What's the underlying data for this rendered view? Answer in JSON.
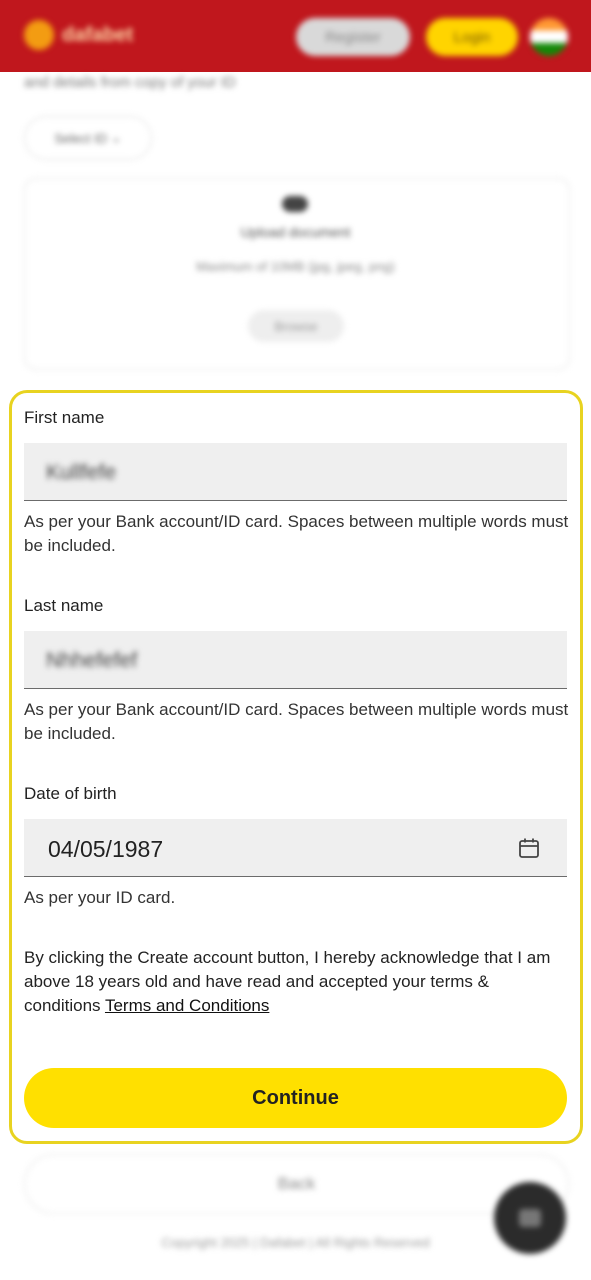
{
  "header": {
    "logo_text": "dafabet",
    "register_label": "Register",
    "login_label": "Login",
    "flag_icon": "india-flag-icon",
    "brand_color": "#c0171d",
    "accent_color": "#ffd400"
  },
  "upload": {
    "intro_text": "and details from copy of your ID",
    "select_id_label": "Select ID",
    "title": "Upload document",
    "subtitle": "Maximum of 10MB (jpg, jpeg, png)",
    "browse_label": "Browse"
  },
  "form": {
    "first_name": {
      "label": "First name",
      "value": "Kullfefe",
      "helper": "As per your Bank account/ID card. Spaces between multiple words must be included."
    },
    "last_name": {
      "label": "Last name",
      "value": "Nhhefefef",
      "helper": "As per your Bank account/ID card. Spaces between multiple words must be included."
    },
    "dob": {
      "label": "Date of birth",
      "value": "04/05/1987",
      "helper": "As per your ID card."
    },
    "terms_text": "By clicking the Create account button, I hereby acknowledge that I am above 18 years old and have read and accepted your terms & conditions ",
    "terms_link": "Terms and Conditions",
    "continue_label": "Continue",
    "highlight_color": "#e8d320"
  },
  "footer": {
    "back_label": "Back",
    "copyright": "Copyright 2025 | Dafabet | All Rights Reserved",
    "chat_icon": "chat-icon"
  }
}
